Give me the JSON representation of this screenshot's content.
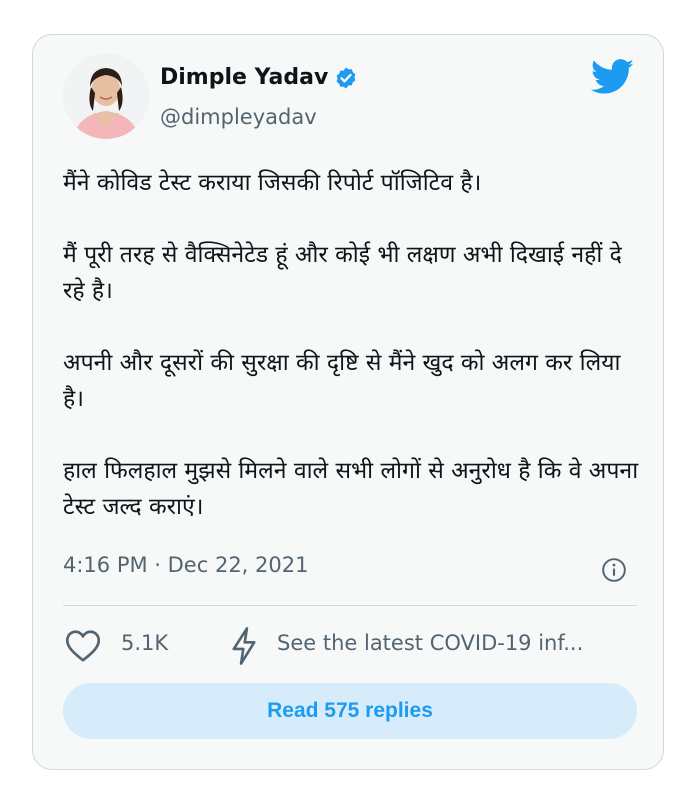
{
  "author": {
    "name": "Dimple Yadav",
    "handle": "@dimpleyadav",
    "verified": true,
    "avatar": "profile-photo"
  },
  "brand": {
    "icon": "twitter-bird-icon",
    "color": "#1d9bf0"
  },
  "tweet": {
    "paragraphs": [
      "मैंने कोविड टेस्ट कराया जिसकी रिपोर्ट पॉजिटिव है।",
      "मैं पूरी तरह से वैक्सिनेटेड हूं और कोई भी लक्षण अभी दिखाई नहीं दे रहे है।",
      "अपनी और दूसरों की सुरक्षा की दृष्टि से मैंने खुद को अलग कर लिया है।",
      "हाल फिलहाल मुझसे मिलने वाले सभी लोगों से अनुरोध है कि वे अपना टेस्ट जल्द कराएं।"
    ],
    "timestamp": "4:16 PM · Dec 22, 2021"
  },
  "actions": {
    "likes": "5.1K",
    "covid_link": "See the latest COVID-19 inf..."
  },
  "replies_button": "Read 575 replies",
  "colors": {
    "accent": "#1d9bf0",
    "muted": "#536471",
    "text": "#0f1419",
    "button_bg": "#d6ecfb"
  }
}
